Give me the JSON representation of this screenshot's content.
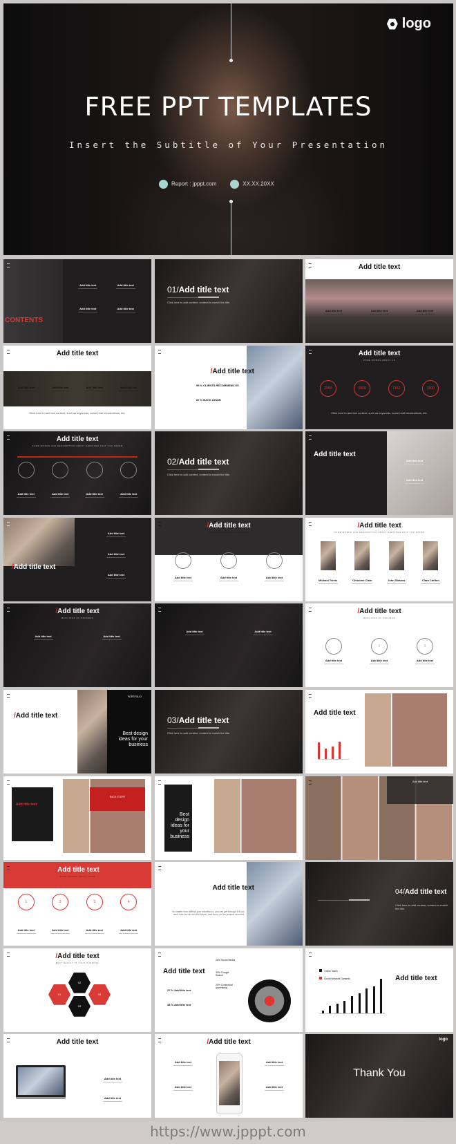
{
  "hero": {
    "logo": "logo",
    "title": "FREE PPT TEMPLATES",
    "subtitle": "Insert the Subtitle of Your Presentation",
    "report": "Report : jpppt.com",
    "date": "XX.XX.20XX"
  },
  "slides": [
    {
      "bg": "dark",
      "photo": "contents",
      "label": "CONTENTS",
      "title": "",
      "items": [
        "Add title text",
        "Add title text",
        "Add title text",
        "Add title text"
      ],
      "layout": "grid"
    },
    {
      "bg": "darker",
      "photo": "full",
      "prefix": "01/",
      "title": "Add title text",
      "pos": "left-mid",
      "section": true,
      "body": "Click here to add content, content to match the title."
    },
    {
      "bg": "light",
      "photo": "band",
      "title": "Add title text",
      "pos": "center-top",
      "items": [
        "Add title text",
        "Add title text",
        "Add title text"
      ],
      "itemsTop": 72
    },
    {
      "bg": "light",
      "photo": "darkband",
      "title": "Add title text",
      "pos": "center-top",
      "items": [
        "Add title text",
        "Add title text",
        "Add title text",
        "Add title text"
      ],
      "itemsTop": 58,
      "body": "Click here to add text content, such as keywords, some brief introductions, etc."
    },
    {
      "bg": "light",
      "photo": "right",
      "slash": true,
      "title": "Add title text",
      "pos": "right-top",
      "stats": [
        "96 % CLIENTS RECOMMEND US",
        "87 % BACK AGAIN"
      ]
    },
    {
      "bg": "dark",
      "title": "Add title text",
      "pos": "center-top",
      "sub": "SOME WORDS ABOUT US",
      "circles": [
        "2500",
        "5600",
        "7152",
        "1500"
      ],
      "body": "Click here to add text content, such as keywords, some brief introductions, etc."
    },
    {
      "bg": "darker",
      "title": "Add title text",
      "pos": "center-top",
      "sub": "SOME WORDS AND DESCRIPTION ABOUT SERVICES THAT YOU OFFER",
      "timeline": true,
      "plainCircles": [
        "",
        "",
        "",
        ""
      ],
      "items": [
        "Add title text",
        "Add title text",
        "Add title text",
        "Add title text"
      ],
      "itemsTop": 88
    },
    {
      "bg": "darker",
      "photo": "full",
      "prefix": "02/",
      "title": "Add title text",
      "pos": "left-mid",
      "section": true,
      "body": "Click here to add content, content to match the title."
    },
    {
      "bg": "dark",
      "photo": "card-right",
      "title": "Add title text",
      "pos": "left-mid2",
      "items": [
        "Add title text",
        "Add title text"
      ],
      "itemsTop": 40,
      "itemsRight": true
    },
    {
      "bg": "dark",
      "photo": "left-top",
      "slash": true,
      "title": "Add title text",
      "pos": "left-low",
      "items": [
        "Add title text",
        "Add title text",
        "Add title text"
      ],
      "vertical": true
    },
    {
      "bg": "light",
      "photo": "topdark",
      "slash": true,
      "title": "Add title text",
      "pos": "center-top",
      "dark_title": true,
      "sub": "SOME WORDS ABOUT SERVICE",
      "plainCircles": [
        "",
        "",
        ""
      ],
      "items": [
        "Add title text",
        "Add title text",
        "Add title text"
      ],
      "itemsTop": 84
    },
    {
      "bg": "light",
      "slash": true,
      "title": "Add title text",
      "pos": "center-top",
      "sub": "SOME WORDS AND DESCRIPTION ABOUT SERVICES THAT YOU OFFER",
      "people": true,
      "items": [
        "Michael Trevis",
        "Christine Clain",
        "John Strauss",
        "Clara Carlton"
      ],
      "itemsTop": 88
    },
    {
      "bg": "darker",
      "slash": true,
      "title": "Add title text",
      "pos": "center-top",
      "sub": "MAIN STEP OF PROCESS",
      "items": [
        "Add title text",
        "Add title text"
      ],
      "itemsTop": 45
    },
    {
      "bg": "darker",
      "items": [
        "Add title text",
        "Add title text"
      ],
      "itemsTop": 38,
      "title": ""
    },
    {
      "bg": "light",
      "slash": true,
      "title": "Add title text",
      "pos": "center-top",
      "sub": "MAIN STEP OF PROCESS",
      "plainCircles": [
        "",
        "2",
        "3"
      ],
      "items": [
        "Add title text",
        "Add title text",
        "Add title text"
      ],
      "itemsTop": 80
    },
    {
      "bg": "light",
      "photo": "mid",
      "slash": true,
      "title": "Add title text",
      "pos": "left-top",
      "portfolio": "PORTFOLIO",
      "big": "Best design ideas for your business"
    },
    {
      "bg": "darker",
      "photo": "full",
      "prefix": "03/",
      "title": "Add title text",
      "pos": "left-mid",
      "section": true,
      "body": "Click here to add content, content to match the title."
    },
    {
      "bg": "light",
      "photo": "collage",
      "title": "Add title text",
      "pos": "left-mid2",
      "bars": true
    },
    {
      "bg": "light",
      "photo": "collage",
      "title": "Add title text",
      "pos": "left-mid2",
      "backstory": "BACK STORY",
      "darkbox": true
    },
    {
      "bg": "light",
      "photo": "collage",
      "title": "",
      "big": "Best design ideas for your business",
      "darkcol": true
    },
    {
      "bg": "light",
      "photo": "collage-full",
      "title": "",
      "caption": "Add title text"
    },
    {
      "bg": "light",
      "photo": "redtop",
      "slash": true,
      "title": "Add title text",
      "pos": "center-top",
      "white_title": true,
      "sub": "SOME WORDS ABOUT CASE",
      "circles": [
        "1",
        "2",
        "3",
        "4"
      ],
      "items": [
        "Add title text",
        "Add title text",
        "Add title text",
        "Add title text"
      ],
      "itemsTop": 96
    },
    {
      "bg": "light",
      "photo": "right",
      "title": "Add title text",
      "pos": "right-top",
      "quote": "No matter how difficult your situation is, you can get through it if you don't look too far into the future, and focus on the present moment."
    },
    {
      "bg": "darker",
      "photo": "full",
      "prefix": "04/",
      "title": "Add title text",
      "pos": "right-mid",
      "section": true,
      "body": "Click here to add content, content to match the title."
    },
    {
      "bg": "light",
      "slash": true,
      "title": "Add title text",
      "pos": "center-top",
      "sub": "BEST RESULT IS YOUR PURPOSE",
      "hex": [
        "01",
        "02",
        "03",
        "04"
      ]
    },
    {
      "bg": "light",
      "title": "Add title text",
      "pos": "left-mid2",
      "target": [
        "20% Social Media",
        "30% Google Search",
        "20% Contextual advertising"
      ],
      "stats": [
        "27 % Add title text",
        "38 % Add title text"
      ]
    },
    {
      "bg": "light",
      "title": "Add title text",
      "pos": "right-mid",
      "legend": [
        "Online Sales",
        "Social Network Dynamic"
      ],
      "chart": [
        1,
        3,
        4,
        5,
        7,
        8,
        10,
        11,
        14
      ]
    },
    {
      "bg": "light",
      "title": "Add title text",
      "pos": "center-top",
      "laptop": true,
      "items": [
        "Add title text",
        "Add title text"
      ],
      "itemsTop": 62,
      "itemsRight": true
    },
    {
      "bg": "light",
      "slash": true,
      "title": "Add title text",
      "pos": "center-top",
      "phone": true,
      "items": [
        "Add title text",
        "Add title text",
        "Add title text",
        "Add title text"
      ],
      "itemsTop": 44
    },
    {
      "bg": "darker",
      "photo": "full",
      "title": "Thank You",
      "pos": "center-mid",
      "logo": "logo"
    }
  ],
  "footer": {
    "url": "https://www.jpppt.com"
  },
  "colors": {
    "accent": "#d83a36",
    "dark": "#1f1d1e",
    "frame": "#c9c8c6"
  }
}
